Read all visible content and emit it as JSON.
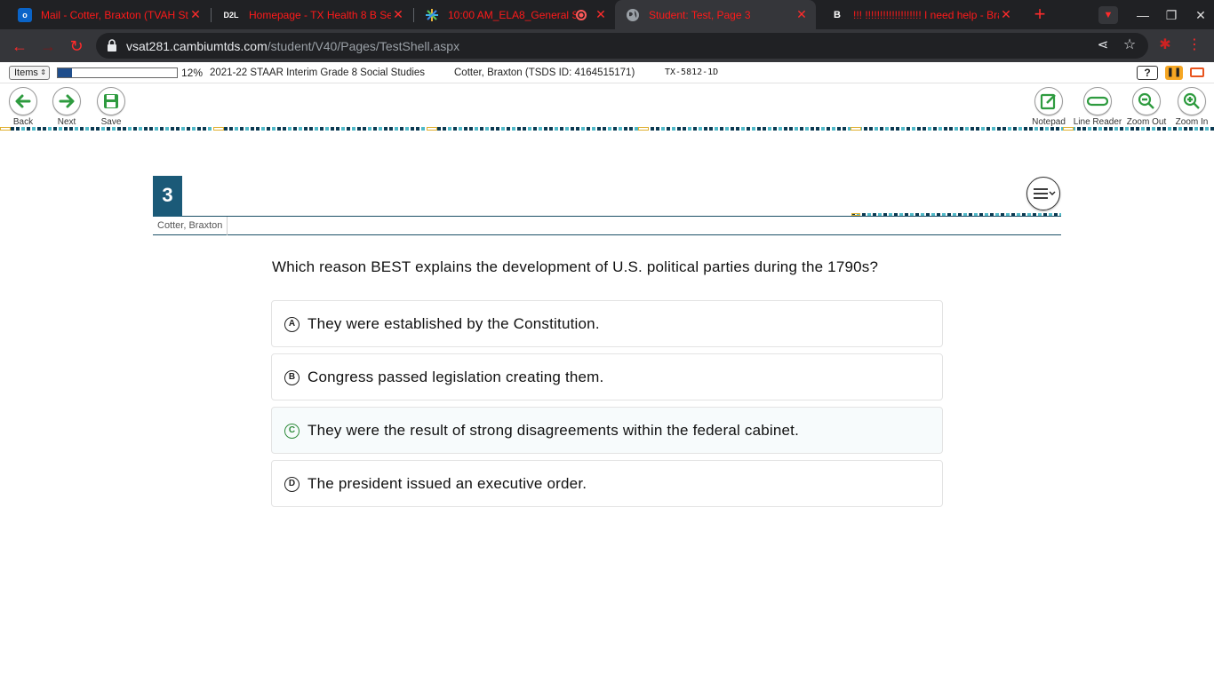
{
  "browser": {
    "tabs": [
      {
        "title": "Mail - Cotter, Braxton (TVAH Stu",
        "favicon": "outlook-icon"
      },
      {
        "title": "Homepage - TX Health 8 B Sec",
        "favicon": "d2l-icon"
      },
      {
        "title": "10:00 AM_ELA8_General S",
        "favicon": "zoom-icon"
      },
      {
        "title": "Student: Test, Page 3",
        "favicon": "globe-icon"
      },
      {
        "title": "!!! !!!!!!!!!!!!!!!!!!! I need help - Bra",
        "favicon": "brainly-icon"
      }
    ],
    "url_host": "vsat281.cambiumtds.com",
    "url_path": "/student/V40/Pages/TestShell.aspx",
    "accent": "#ff2b2b"
  },
  "infobar": {
    "items_label": "Items",
    "progress_fraction": 0.12,
    "progress_text": "12%",
    "test_name": "2021-22 STAAR Interim Grade 8 Social Studies",
    "student": "Cotter, Braxton (TSDS ID: 4164515171)",
    "form_id": "TX-5812-1D",
    "help_label": "?"
  },
  "tools": {
    "back": "Back",
    "next": "Next",
    "save": "Save",
    "notepad": "Notepad",
    "line_reader": "Line Reader",
    "zoom_out": "Zoom Out",
    "zoom_in": "Zoom In",
    "accent": "#2e9b3f"
  },
  "question": {
    "number": "3",
    "student_name": "Cotter, Braxton",
    "stem": "Which reason BEST explains the development of U.S. political parties during the 1790s?",
    "options": [
      {
        "letter": "A",
        "text": "They were established by the Constitution."
      },
      {
        "letter": "B",
        "text": "Congress passed legislation creating them."
      },
      {
        "letter": "C",
        "text": "They were the result of strong disagreements within the federal cabinet."
      },
      {
        "letter": "D",
        "text": "The president issued an executive order."
      }
    ]
  }
}
